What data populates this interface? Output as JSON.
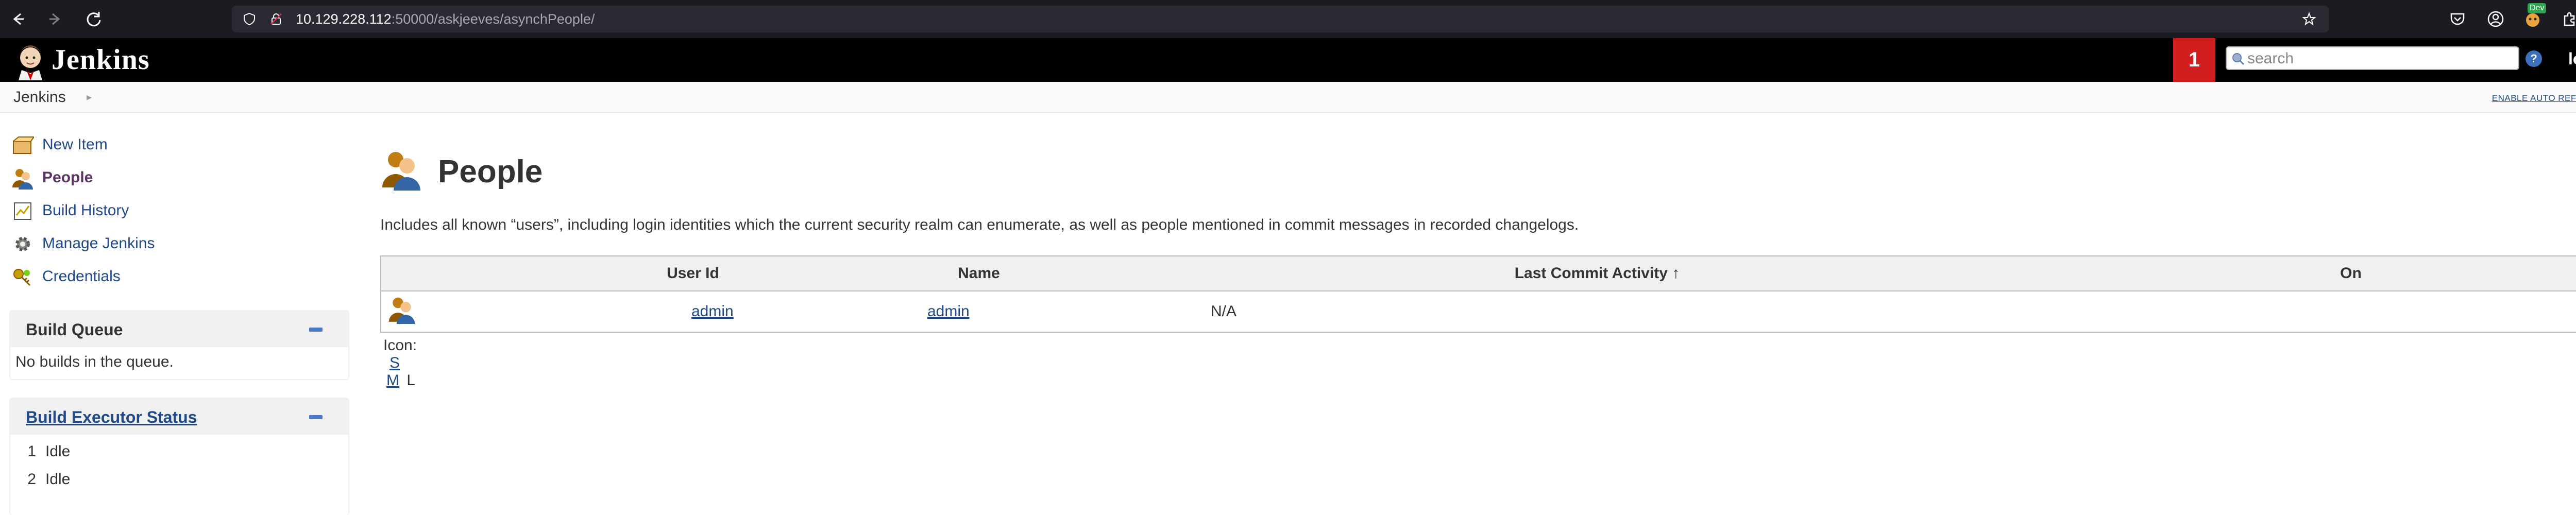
{
  "browser": {
    "url_host": "10.129.228.112",
    "url_rest": ":50000/askjeeves/asynchPeople/",
    "extension_badge": "Dev"
  },
  "header": {
    "brand": "Jenkins",
    "notification_count": "1",
    "search_placeholder": "search",
    "help": "?",
    "login": "log in"
  },
  "breadcrumb": {
    "items": [
      "Jenkins"
    ],
    "auto_refresh": "ENABLE AUTO REFRESH"
  },
  "sidebar": {
    "tasks": [
      {
        "label": "New Item",
        "icon": "new-item-icon"
      },
      {
        "label": "People",
        "icon": "people-icon",
        "active": true
      },
      {
        "label": "Build History",
        "icon": "build-history-icon"
      },
      {
        "label": "Manage Jenkins",
        "icon": "gear-icon"
      },
      {
        "label": "Credentials",
        "icon": "credentials-icon"
      }
    ],
    "build_queue": {
      "title": "Build Queue",
      "empty_text": "No builds in the queue."
    },
    "executors": {
      "title": "Build Executor Status",
      "rows": [
        {
          "num": "1",
          "status": "Idle"
        },
        {
          "num": "2",
          "status": "Idle"
        }
      ]
    }
  },
  "main": {
    "title": "People",
    "description": "Includes all known “users”, including login identities which the current security realm can enumerate, as well as people mentioned in commit messages in recorded changelogs.",
    "table": {
      "headers": [
        "",
        "User Id",
        "Name",
        "Last Commit Activity ↑",
        "On"
      ],
      "rows": [
        {
          "user_id": "admin",
          "name": "admin",
          "last_commit": "N/A",
          "on": ""
        }
      ]
    },
    "icon_size": {
      "label": "Icon:",
      "sizes": [
        "S",
        "M",
        "L"
      ]
    }
  },
  "colors": {
    "header_bg": "#000000",
    "notification_bg": "#d21e1e",
    "link": "#204a87",
    "active_task": "#5c3566"
  }
}
